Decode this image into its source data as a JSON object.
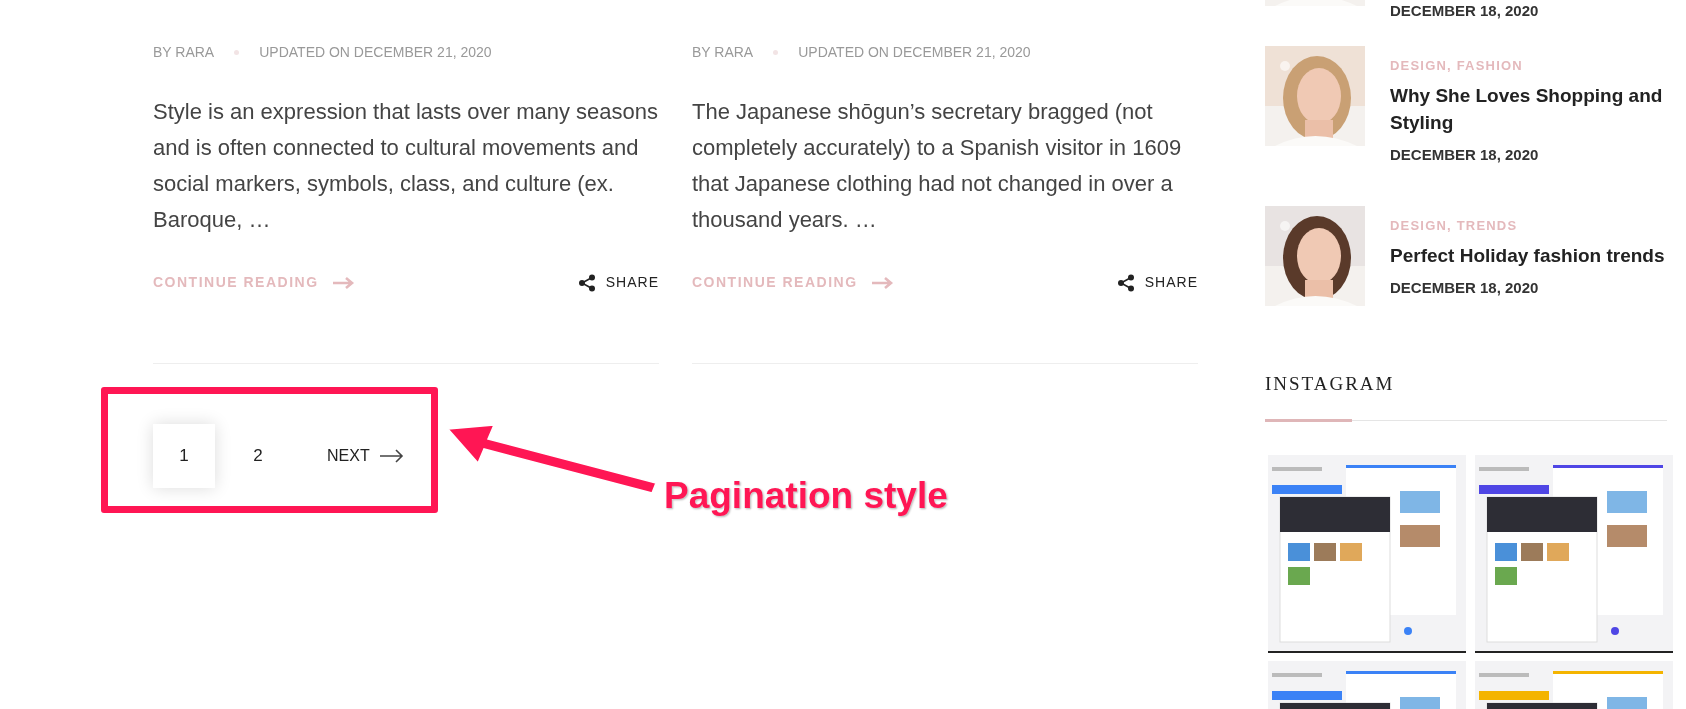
{
  "posts": [
    {
      "author": "BY RARA",
      "updated": "UPDATED ON DECEMBER 21, 2020",
      "excerpt": "Style is an expression that lasts over many seasons and is often connected to cultural movements and social markers, symbols, class, and culture (ex. Baroque, …",
      "read_more": "CONTINUE READING",
      "share": "SHARE"
    },
    {
      "author": "BY RARA",
      "updated": "UPDATED ON DECEMBER 21, 2020",
      "excerpt": "The Japanese shōgun’s secretary bragged (not completely accurately) to a Spanish visitor in 1609 that Japanese clothing had not changed in over a thousand years. …",
      "read_more": "CONTINUE READING",
      "share": "SHARE"
    }
  ],
  "pagination": {
    "pages": [
      {
        "label": "1",
        "selected": true
      },
      {
        "label": "2",
        "selected": false
      }
    ],
    "next": "NEXT"
  },
  "annotation": {
    "label": "Pagination style"
  },
  "sidebar": {
    "recent_posts": [
      {
        "date": "DECEMBER 18, 2020"
      },
      {
        "categories": "DESIGN, FASHION",
        "title": "Why She Loves Shopping and Styling",
        "date": "DECEMBER 18, 2020"
      },
      {
        "categories": "DESIGN, TRENDS",
        "title": "Perfect Holiday fashion trends",
        "date": "DECEMBER 18, 2020"
      }
    ],
    "instagram": {
      "title": "INSTAGRAM"
    }
  }
}
